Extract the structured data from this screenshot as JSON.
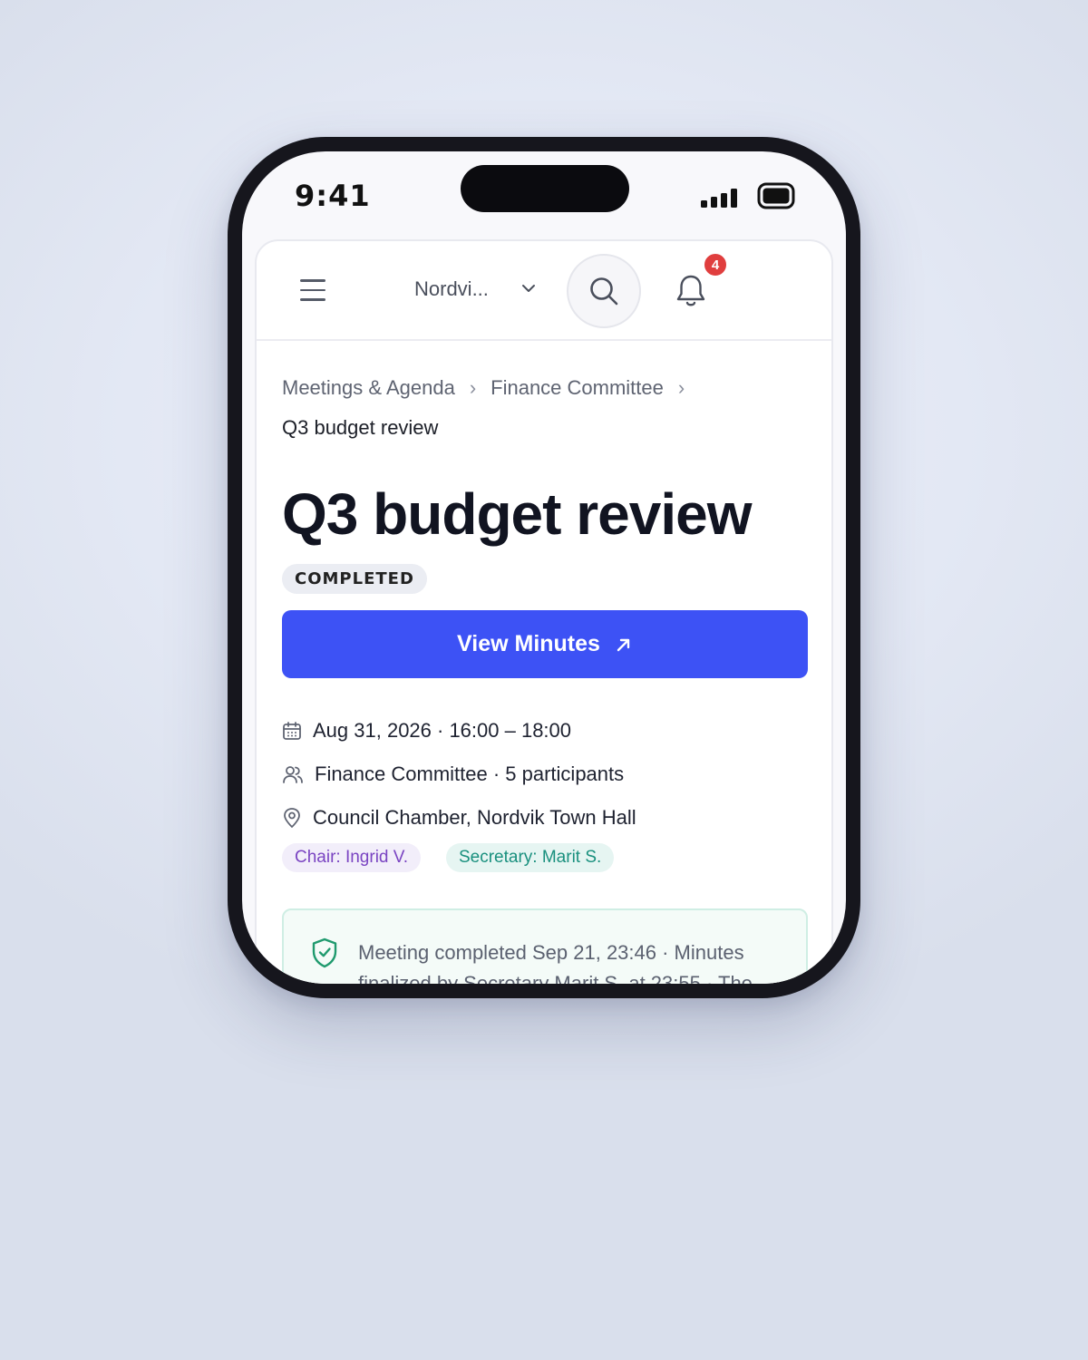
{
  "status_bar": {
    "time": "9:41"
  },
  "header": {
    "org_select": "Nordvi...",
    "notification_count": "4"
  },
  "breadcrumb": {
    "items": [
      "Meetings & Agenda",
      "Finance Committee"
    ],
    "current": "Q3 budget review"
  },
  "meeting": {
    "title": "Q3 budget review",
    "status": "COMPLETED",
    "primary_action": "View Minutes",
    "datetime": "Aug 31, 2026 · 16:00 – 18:00",
    "committee": "Finance Committee · 5 participants",
    "location": "Council Chamber, Nordvik Town Hall",
    "chair": "Chair: Ingrid V.",
    "secretary": "Secretary: Marit S.",
    "notice": "Meeting completed Sep 21, 23:46 · Minutes finalized by Secretary Marit S. at 23:55 · The"
  },
  "colors": {
    "accent": "#3d52f5",
    "badge_red": "#e03e3e",
    "chair_purple": "#7a44c2",
    "secretary_teal": "#19907e",
    "success_green": "#1f9a6e"
  },
  "icons": [
    "menu-icon",
    "chevron-down-icon",
    "search-icon",
    "bell-icon",
    "external-link-icon",
    "calendar-icon",
    "users-icon",
    "map-pin-icon",
    "shield-check-icon",
    "signal-icon",
    "battery-icon"
  ]
}
